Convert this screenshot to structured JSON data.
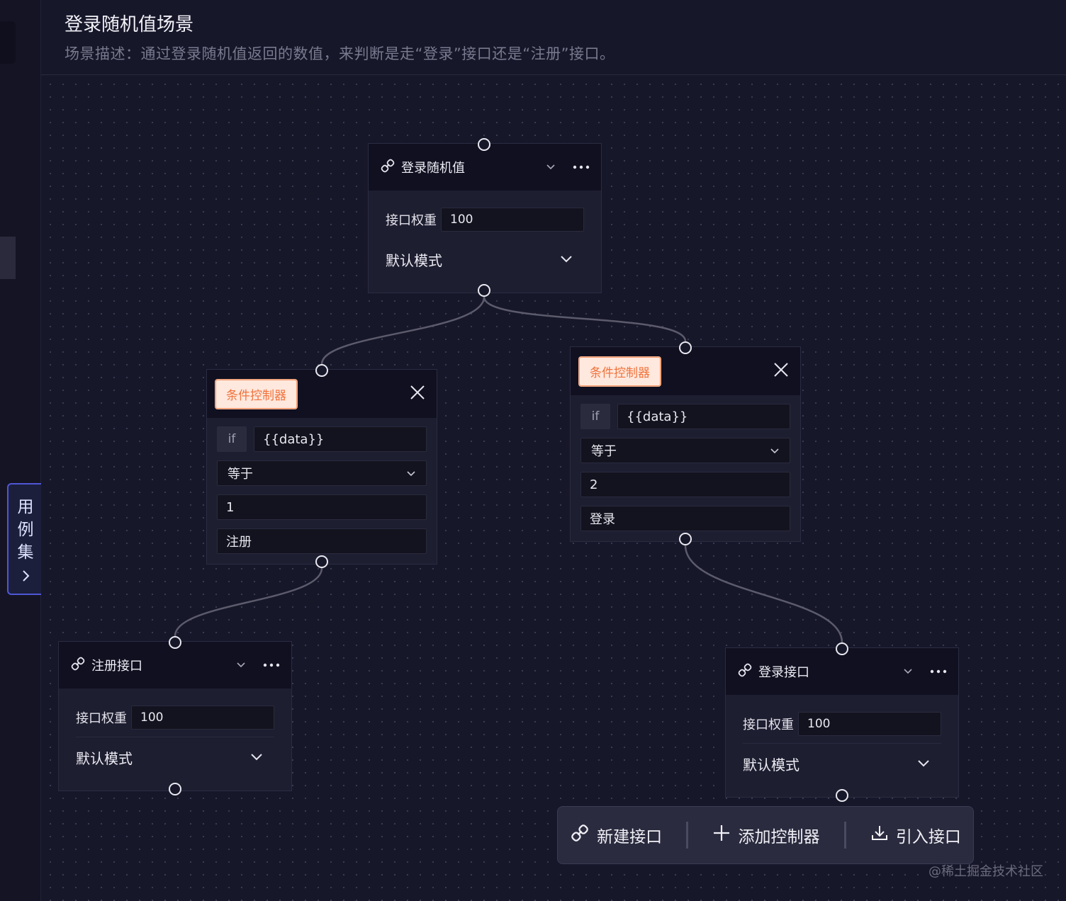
{
  "header": {
    "title": "登录随机值场景",
    "description": "场景描述：通过登录随机值返回的数值，来判断是走“登录”接口还是“注册”接口。"
  },
  "sidebar": {
    "drawer_chars": [
      "用",
      "例",
      "集"
    ]
  },
  "nodes": {
    "random": {
      "name": "登录随机值",
      "weight_label": "接口权重",
      "weight_value": "100",
      "mode": "默认模式"
    },
    "cond_left": {
      "tag": "条件控制器",
      "if_label": "if",
      "variable": "{{data}}",
      "operator": "等于",
      "value": "1",
      "target": "注册"
    },
    "cond_right": {
      "tag": "条件控制器",
      "if_label": "if",
      "variable": "{{data}}",
      "operator": "等于",
      "value": "2",
      "target": "登录"
    },
    "register": {
      "name": "注册接口",
      "weight_label": "接口权重",
      "weight_value": "100",
      "mode": "默认模式"
    },
    "login": {
      "name": "登录接口",
      "weight_label": "接口权重",
      "weight_value": "100",
      "mode": "默认模式"
    }
  },
  "toolbar": {
    "new_api": "新建接口",
    "add_controller": "添加控制器",
    "import_api": "引入接口"
  },
  "watermark": "@稀土掘金技术社区",
  "icons": {
    "api": "link-icon",
    "dropdown": "chevron-down-icon",
    "more": "more-dots-icon",
    "close": "close-icon",
    "add": "plus-icon",
    "import": "download-icon",
    "drawer": "chevron-right-icon"
  },
  "colors": {
    "background": "#17172a",
    "node_header": "#101020",
    "tag_bg": "#ffe8de",
    "tag_text": "#f0733c",
    "drawer_border": "#4f57d6"
  }
}
